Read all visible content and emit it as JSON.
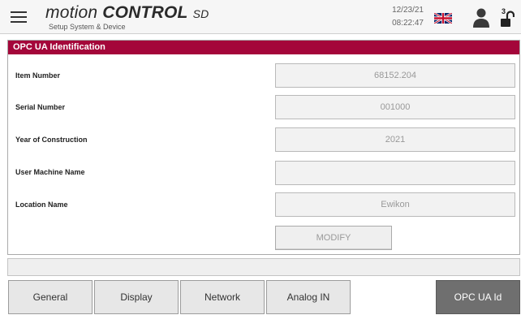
{
  "header": {
    "brand_prefix": "motion",
    "brand_strong": "CONTROL",
    "brand_suffix": "SD",
    "subtitle": "Setup System & Device",
    "date": "12/23/21",
    "time": "08:22:47",
    "lock_count": "3"
  },
  "icons": {
    "menu": "hamburger-menu-icon",
    "language": "uk-flag-icon",
    "user": "user-icon",
    "lock": "unlocked-padlock-icon"
  },
  "panel": {
    "title": "OPC UA Identification",
    "fields": [
      {
        "label": "Item Number",
        "value": "68152.204"
      },
      {
        "label": "Serial Number",
        "value": "001000"
      },
      {
        "label": "Year of Construction",
        "value": "2021"
      },
      {
        "label": "User Machine Name",
        "value": ""
      },
      {
        "label": "Location Name",
        "value": "Ewikon"
      }
    ],
    "modify_label": "MODIFY"
  },
  "status_text": "",
  "tabs": [
    {
      "label": "General",
      "active": false
    },
    {
      "label": "Display",
      "active": false
    },
    {
      "label": "Network",
      "active": false
    },
    {
      "label": "Analog IN",
      "active": false
    },
    {
      "label": "OPC UA Id",
      "active": true
    }
  ],
  "colors": {
    "panel_title_bg": "#a4063a",
    "active_tab_bg": "#6f6f6f",
    "field_bg": "#f2f2f2"
  }
}
